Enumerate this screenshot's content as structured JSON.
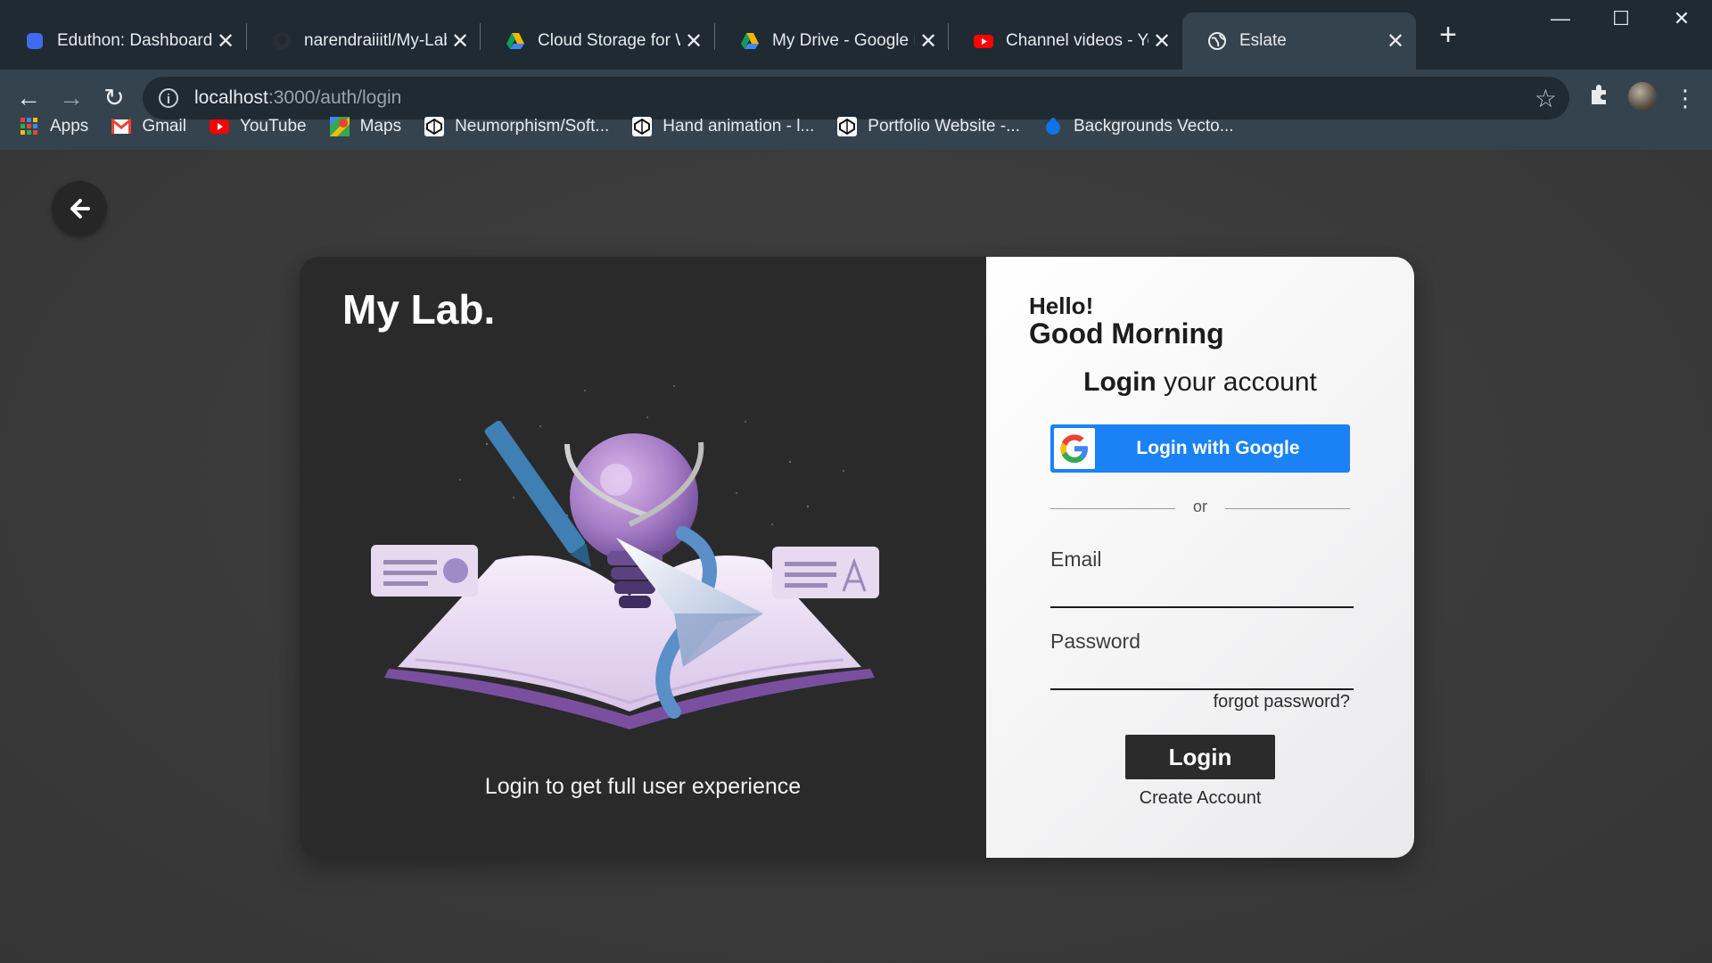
{
  "browser": {
    "tabs": [
      {
        "title": "Eduthon: Dashboard",
        "icon": "eduthon-favicon"
      },
      {
        "title": "narendraiiitl/My-Lab",
        "icon": "github-favicon"
      },
      {
        "title": "Cloud Storage for W",
        "icon": "google-drive-favicon"
      },
      {
        "title": "My Drive - Google D",
        "icon": "google-drive-favicon"
      },
      {
        "title": "Channel videos - You",
        "icon": "youtube-favicon"
      },
      {
        "title": "Eslate",
        "icon": "globe-favicon",
        "active": true
      }
    ],
    "url_host": "localhost",
    "url_rest": ":3000/auth/login",
    "bookmarks": [
      {
        "label": "Apps",
        "icon": "apps-grid-icon"
      },
      {
        "label": "Gmail",
        "icon": "gmail-icon"
      },
      {
        "label": "YouTube",
        "icon": "youtube-icon"
      },
      {
        "label": "Maps",
        "icon": "maps-icon"
      },
      {
        "label": "Neumorphism/Soft...",
        "icon": "codepen-icon"
      },
      {
        "label": "Hand animation - l...",
        "icon": "codepen-icon"
      },
      {
        "label": "Portfolio Website -...",
        "icon": "codepen-icon"
      },
      {
        "label": "Backgrounds Vecto...",
        "icon": "freepik-icon"
      }
    ]
  },
  "left_panel": {
    "brand": "My Lab.",
    "tagline": "Login to get full user experience"
  },
  "login_panel": {
    "hello": "Hello!",
    "greeting": "Good Morning",
    "title_bold": "Login",
    "title_rest": " your account",
    "google_button": "Login with Google",
    "divider_text": "or",
    "email_label": "Email",
    "email_value": "",
    "password_label": "Password",
    "password_value": "",
    "forgot": "forgot password?",
    "login_button": "Login",
    "create_account": "Create Account"
  },
  "colors": {
    "google_blue": "#1a82f5",
    "dark_panel": "#2a2a2a",
    "page_bg": "#3c3c3c"
  }
}
